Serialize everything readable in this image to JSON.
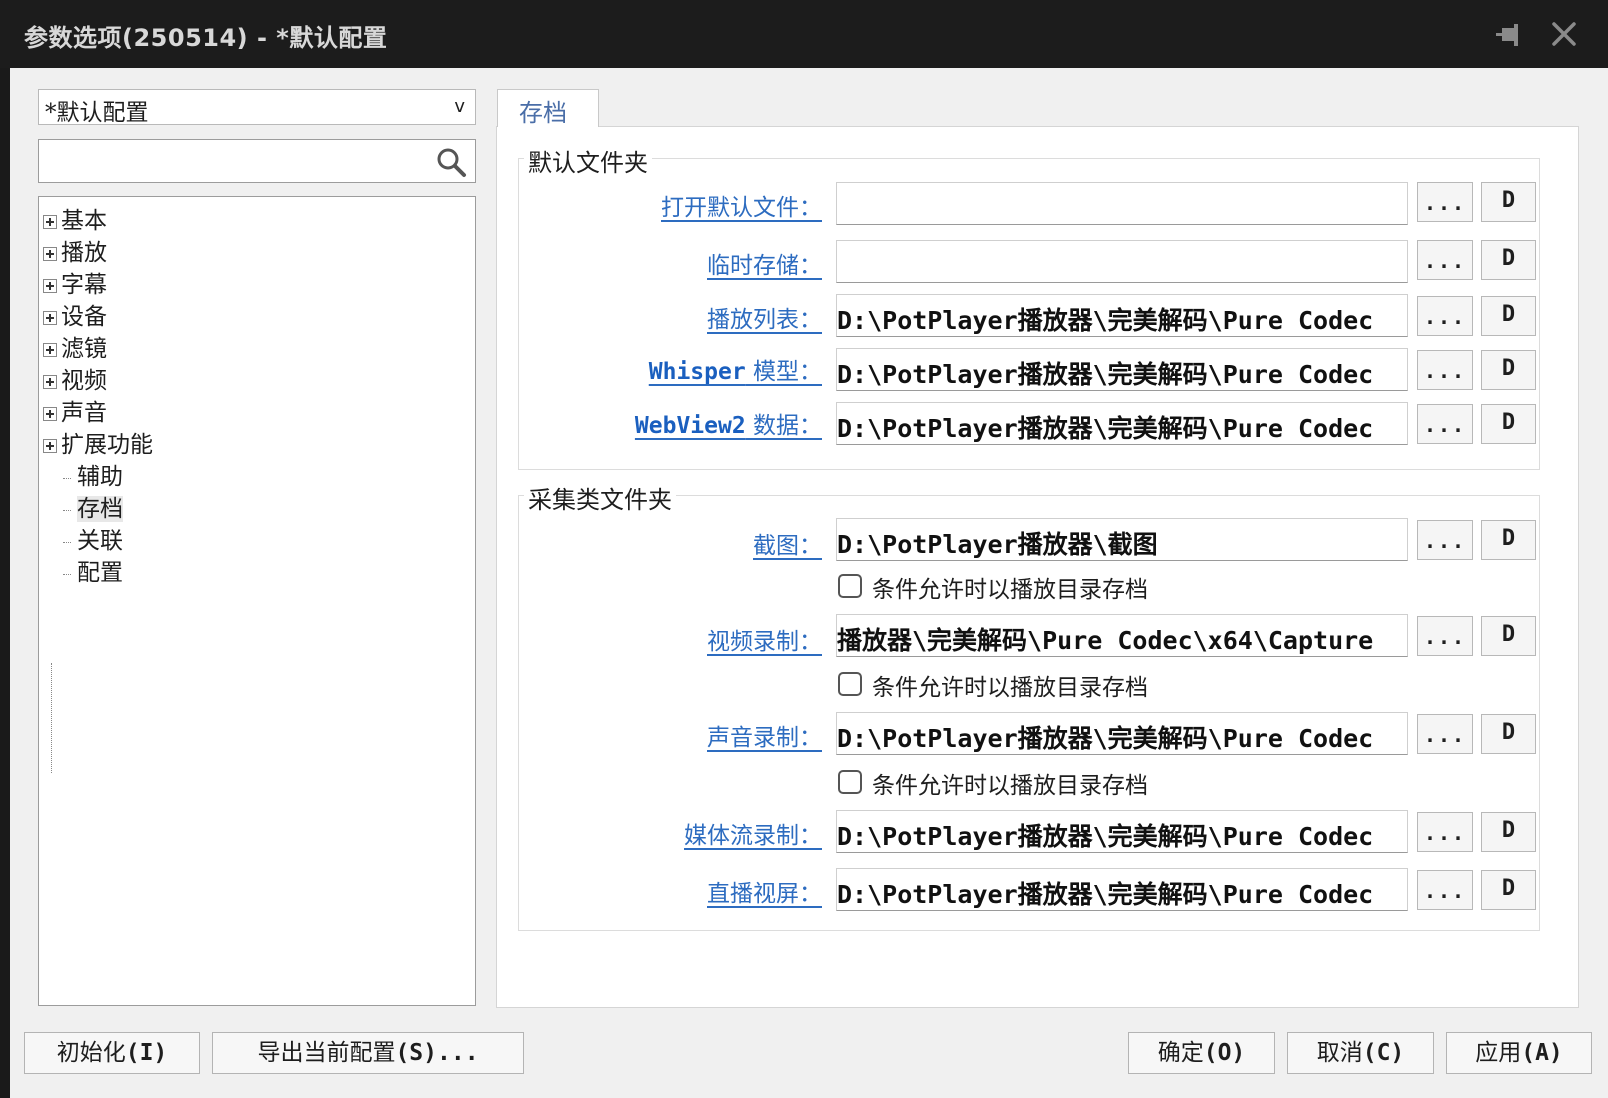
{
  "window": {
    "title": "参数选项(250514) - *默认配置"
  },
  "profile": {
    "value": "*默认配置",
    "arrow": "v"
  },
  "tree": {
    "items": [
      {
        "label": "基本",
        "expandable": true
      },
      {
        "label": "播放",
        "expandable": true
      },
      {
        "label": "字幕",
        "expandable": true
      },
      {
        "label": "设备",
        "expandable": true
      },
      {
        "label": "滤镜",
        "expandable": true
      },
      {
        "label": "视频",
        "expandable": true
      },
      {
        "label": "声音",
        "expandable": true
      },
      {
        "label": "扩展功能",
        "expandable": true
      },
      {
        "label": "辅助",
        "expandable": false
      },
      {
        "label": "存档",
        "expandable": false,
        "selected": true
      },
      {
        "label": "关联",
        "expandable": false
      },
      {
        "label": "配置",
        "expandable": false
      }
    ]
  },
  "tab": {
    "label": "存档"
  },
  "default_folders": {
    "title": "默认文件夹",
    "rows": [
      {
        "label": "打开默认文件：",
        "value": ""
      },
      {
        "label": "临时存储：",
        "value": ""
      },
      {
        "label": "播放列表：",
        "value": "D:\\PotPlayer播放器\\完美解码\\Pure Codec"
      },
      {
        "label_en": "Whisper",
        "label": " 模型：",
        "value": "D:\\PotPlayer播放器\\完美解码\\Pure Codec"
      },
      {
        "label_en": "WebView2",
        "label": " 数据：",
        "value": "D:\\PotPlayer播放器\\完美解码\\Pure Codec"
      }
    ]
  },
  "capture_folders": {
    "title": "采集类文件夹",
    "rows": [
      {
        "label": "截图：",
        "value": "D:\\PotPlayer播放器\\截图"
      },
      {
        "label": "视频录制：",
        "value": "播放器\\完美解码\\Pure Codec\\x64\\Capture"
      },
      {
        "label": "声音录制：",
        "value": "D:\\PotPlayer播放器\\完美解码\\Pure Codec"
      },
      {
        "label": "媒体流录制：",
        "value": "D:\\PotPlayer播放器\\完美解码\\Pure Codec"
      },
      {
        "label": "直播视屏：",
        "value": "D:\\PotPlayer播放器\\完美解码\\Pure Codec"
      }
    ],
    "checkbox_label": "条件允许时以播放目录存档"
  },
  "row_buttons": {
    "browse": "...",
    "default": "D"
  },
  "buttons": {
    "init": {
      "label": "初始化",
      "key": "(I)"
    },
    "export": {
      "label": "导出当前配置",
      "key": "(S)..."
    },
    "ok": {
      "label": "确定",
      "key": "(O)"
    },
    "cancel": {
      "label": "取消",
      "key": "(C)"
    },
    "apply": {
      "label": "应用",
      "key": "(A)"
    }
  }
}
